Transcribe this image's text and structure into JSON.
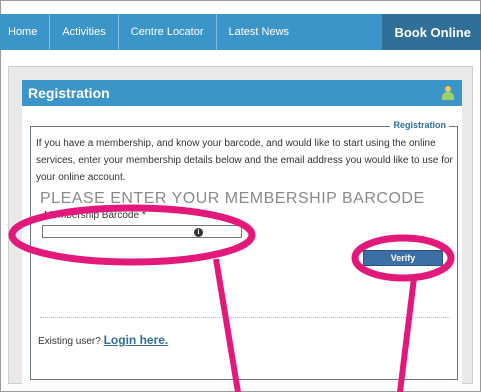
{
  "nav": {
    "items": [
      {
        "label": "Home"
      },
      {
        "label": "Activities"
      },
      {
        "label": "Centre Locator"
      },
      {
        "label": "Latest News"
      }
    ],
    "book_online": "Book Online"
  },
  "registration": {
    "title": "Registration",
    "legend": "Registration",
    "intro": "If you have a membership, and know your barcode, and would like to start using the online services, enter your membership details below and the email address you would like to use for your online account.",
    "barcode_heading": "PLEASE ENTER YOUR MEMBERSHIP BARCODE",
    "barcode_label": "Membership Barcode *",
    "barcode_value": "",
    "verify_label": "Verify",
    "existing_text": "Existing user? ",
    "login_label": "Login here."
  },
  "icons": {
    "user": "user-icon",
    "info": "info-icon"
  },
  "colors": {
    "nav_bg": "#3b95c8",
    "book_online_bg": "#2f6f98",
    "annotation": "#e2197a"
  }
}
